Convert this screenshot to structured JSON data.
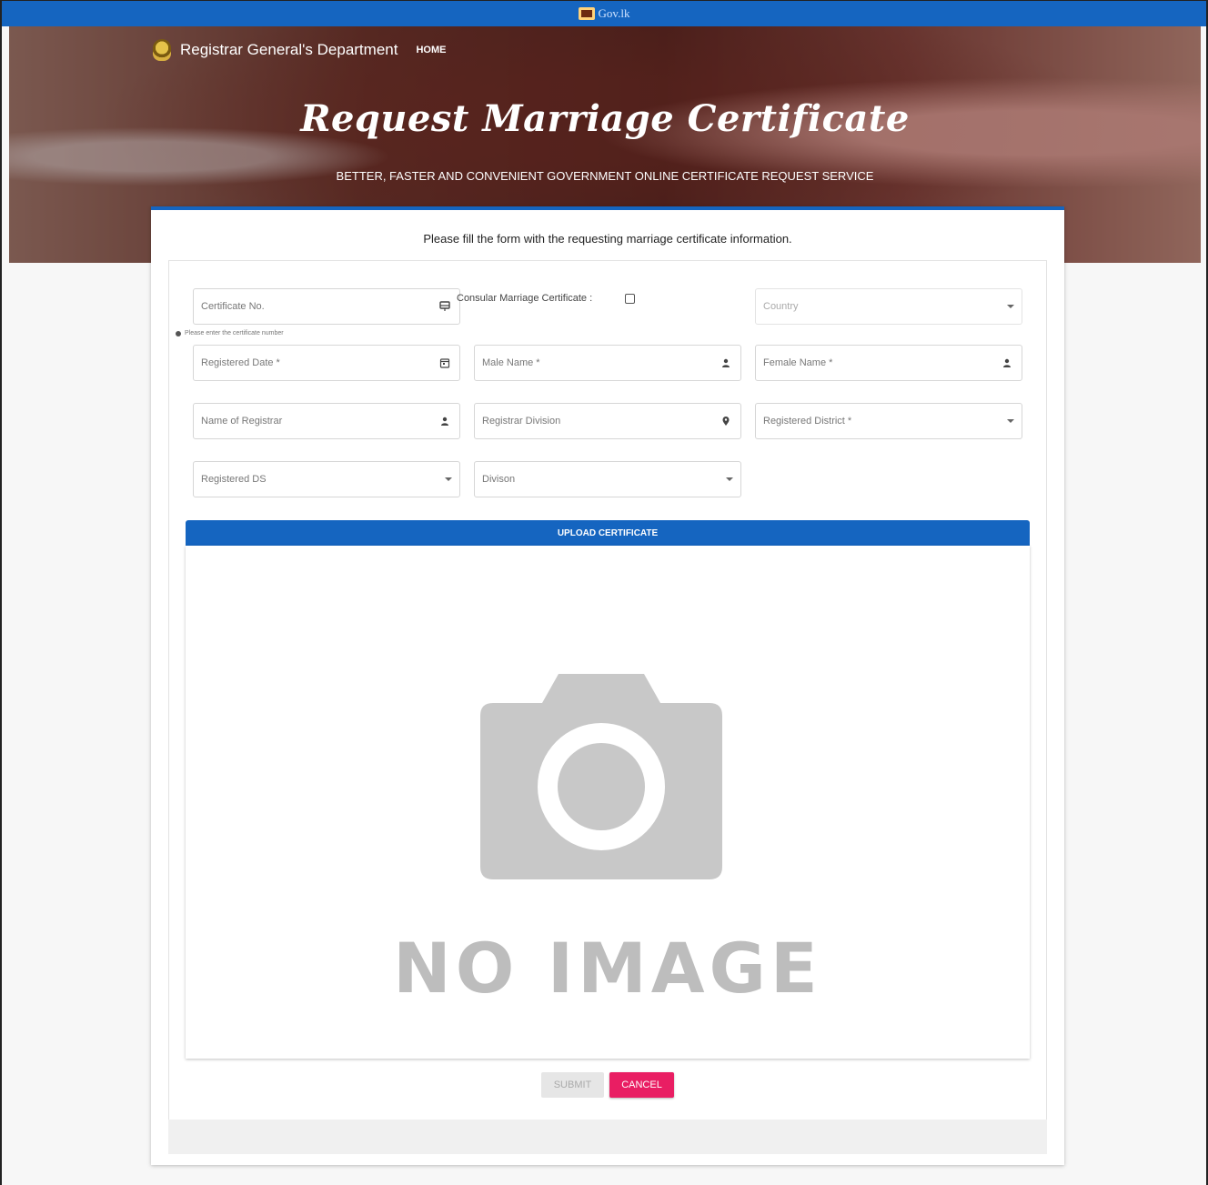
{
  "topbar": {
    "gov_label": "Gov.lk"
  },
  "nav": {
    "dept": "Registrar General's Department",
    "home": "HOME"
  },
  "hero": {
    "title": "Request Marriage Certificate",
    "subtitle": "BETTER, FASTER AND CONVENIENT GOVERNMENT ONLINE CERTIFICATE REQUEST SERVICE"
  },
  "form": {
    "intro": "Please fill the form with the requesting marriage certificate information.",
    "certificate_no": "Certificate No.",
    "certificate_hint": "Please enter the certificate number",
    "consular_label": "Consular Marriage Certificate :",
    "country": "Country",
    "registered_date": "Registered Date *",
    "male_name": "Male Name *",
    "female_name": "Female Name *",
    "name_of_registrar": "Name of Registrar",
    "registrar_division": "Registrar Division",
    "registered_district": "Registered District *",
    "registered_ds": "Registered DS",
    "division": "Divison"
  },
  "upload": {
    "button": "UPLOAD CERTIFICATE",
    "placeholder_text": "NO IMAGE"
  },
  "actions": {
    "submit": "SUBMIT",
    "cancel": "CANCEL"
  },
  "colors": {
    "primary": "#1565c0",
    "cancel": "#e91e63"
  }
}
